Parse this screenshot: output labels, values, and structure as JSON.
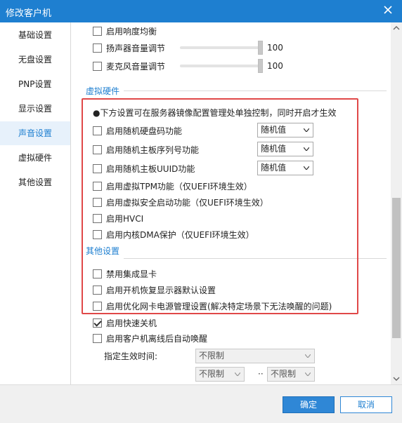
{
  "window": {
    "title": "修改客户机"
  },
  "sidebar": {
    "items": [
      {
        "label": "基础设置"
      },
      {
        "label": "无盘设置"
      },
      {
        "label": "PNP设置"
      },
      {
        "label": "显示设置"
      },
      {
        "label": "声音设置"
      },
      {
        "label": "虚拟硬件"
      },
      {
        "label": "其他设置"
      }
    ],
    "active_index": 4
  },
  "audio": {
    "loudness": {
      "label": "启用响度均衡",
      "checked": false
    },
    "speaker": {
      "label": "扬声器音量调节",
      "checked": false,
      "value": "100"
    },
    "mic": {
      "label": "麦克风音量调节",
      "checked": false,
      "value": "100"
    }
  },
  "virtual_hw": {
    "title": "虚拟硬件",
    "note": "●下方设置可在服务器镜像配置管理处单独控制，同时开启才生效",
    "items": [
      {
        "label": "启用随机硬盘码功能",
        "checked": false,
        "select": "随机值"
      },
      {
        "label": "启用随机主板序列号功能",
        "checked": false,
        "select": "随机值"
      },
      {
        "label": "启用随机主板UUID功能",
        "checked": false,
        "select": "随机值"
      },
      {
        "label": "启用虚拟TPM功能（仅UEFI环境生效）",
        "checked": false
      },
      {
        "label": "启用虚拟安全启动功能（仅UEFI环境生效）",
        "checked": false
      },
      {
        "label": "启用HVCI",
        "checked": false
      },
      {
        "label": "启用内核DMA保护（仅UEFI环境生效）",
        "checked": false
      }
    ]
  },
  "other": {
    "title": "其他设置",
    "items": [
      {
        "label": "禁用集成显卡",
        "checked": false
      },
      {
        "label": "启用开机恢复显示器默认设置",
        "checked": false
      },
      {
        "label": "启用优化网卡电源管理设置(解决特定场景下无法唤醒的问题)",
        "checked": false
      },
      {
        "label": "启用快速关机",
        "checked": true
      },
      {
        "label": "启用客户机离线后自动唤醒",
        "checked": false
      }
    ],
    "time_label": "指定生效时间:",
    "time_select": "不限制",
    "range_start": "不限制",
    "range_sep": "··",
    "range_end": "不限制"
  },
  "footer": {
    "ok": "确定",
    "cancel": "取消"
  },
  "colors": {
    "accent": "#1e7fd0",
    "highlight": "#e04848"
  }
}
